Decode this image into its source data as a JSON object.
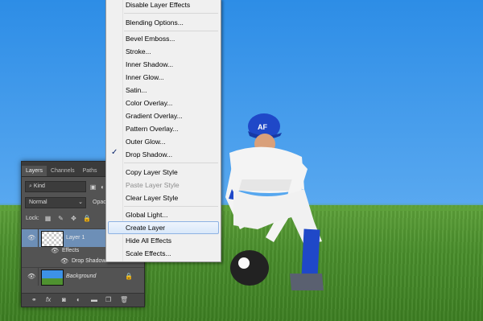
{
  "menu": {
    "items": [
      {
        "label": "Disable Layer Effects",
        "enabled": true
      },
      {
        "label": "Blending Options...",
        "enabled": true
      },
      {
        "label": "Bevel  Emboss...",
        "enabled": true
      },
      {
        "label": "Stroke...",
        "enabled": true
      },
      {
        "label": "Inner Shadow...",
        "enabled": true
      },
      {
        "label": "Inner Glow...",
        "enabled": true
      },
      {
        "label": "Satin...",
        "enabled": true
      },
      {
        "label": "Color Overlay...",
        "enabled": true
      },
      {
        "label": "Gradient Overlay...",
        "enabled": true
      },
      {
        "label": "Pattern Overlay...",
        "enabled": true
      },
      {
        "label": "Outer Glow...",
        "enabled": true
      },
      {
        "label": "Drop Shadow...",
        "enabled": true,
        "checked": true
      },
      {
        "label": "Copy Layer Style",
        "enabled": true
      },
      {
        "label": "Paste Layer Style",
        "enabled": false
      },
      {
        "label": "Clear Layer Style",
        "enabled": true
      },
      {
        "label": "Global Light...",
        "enabled": true
      },
      {
        "label": "Create Layer",
        "enabled": true,
        "highlighted": true
      },
      {
        "label": "Hide All Effects",
        "enabled": true
      },
      {
        "label": "Scale Effects...",
        "enabled": true
      }
    ],
    "check_glyph": "✓"
  },
  "layers_panel": {
    "tabs": [
      "Layers",
      "Channels",
      "Paths"
    ],
    "kind_filter": "Kind",
    "blend_mode": "Normal",
    "opacity_label": "Opac",
    "lock_label": "Lock:",
    "layers": [
      {
        "name": "Layer 1",
        "selected": true,
        "effects_label": "Effects",
        "effect": "Drop Shadow"
      },
      {
        "name": "Background",
        "selected": false,
        "locked": true
      }
    ]
  },
  "icons": [
    "eye-icon",
    "lock-icon",
    "link-icon",
    "fx-icon",
    "mask-icon",
    "adjustment-icon",
    "folder-icon",
    "new-layer-icon",
    "trash-icon"
  ],
  "colors": {
    "sky": "#3b96ea",
    "grass": "#4e922e",
    "panel": "#535353",
    "selected_layer": "#6d8fb7",
    "menu_bg": "#f0f0f0",
    "menu_highlight_border": "#8db2e3"
  }
}
